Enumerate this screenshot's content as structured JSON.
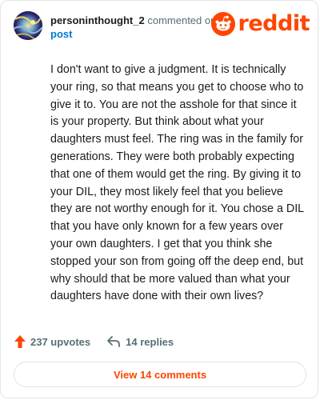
{
  "header": {
    "username": "personinthought_2",
    "commented_text": "commented on",
    "post_link": "post",
    "logo_text": "reddit"
  },
  "comment": {
    "body": "I don't want to give a judgment. It is technically your ring, so that means you get to choose who to give it to. You are not the asshole for that since it is your property. But think about what your daughters must feel. The ring was in the family for generations. They were both probably expecting that one of them would get the ring. By giving it to your DIL, they most likely feel that you believe they are not worthy enough for it. You chose a DIL that you have only known for a few years over your own daughters. I get that you think she stopped your son from going off the deep end, but why should that be more valued than what your daughters have done with their own lives?"
  },
  "footer": {
    "upvotes_label": "237 upvotes",
    "replies_label": "14 replies"
  },
  "view_comments_label": "View 14 comments",
  "colors": {
    "brand": "#ff4500",
    "link": "#0079d3",
    "muted": "#576f76"
  },
  "icons": {
    "upvote": "upvote-arrow-icon",
    "reply": "reply-arrow-icon",
    "logo": "reddit-snoo-icon"
  }
}
